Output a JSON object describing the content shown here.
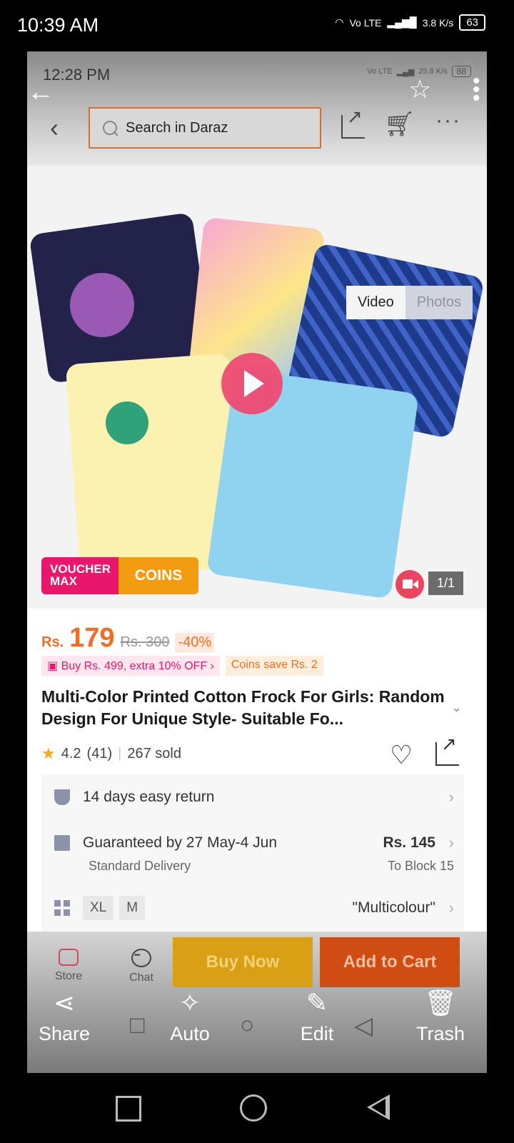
{
  "system": {
    "time": "10:39 AM",
    "network": "Vo LTE",
    "speed": "3.8 K/s",
    "battery": "63"
  },
  "inner_status": {
    "time": "12:28 PM",
    "network": "Vo LTE",
    "speed": "25.8 K/s",
    "battery": "88"
  },
  "search": {
    "placeholder": "Search in Daraz"
  },
  "media": {
    "tabs": [
      "Video",
      "Photos"
    ],
    "counter": "1/1",
    "voucher_label": "VOUCHER MAX",
    "coins_label": "COINS"
  },
  "product": {
    "currency": "Rs.",
    "price": "179",
    "old_price": "Rs. 300",
    "discount": "-40%",
    "promo": "Buy Rs. 499, extra 10% OFF",
    "coins_save": "Coins save Rs. 2",
    "title": "Multi-Color Printed Cotton Frock For Girls: Random Design For Unique Style- Suitable Fo...",
    "rating": "4.2",
    "rating_count": "(41)",
    "sold": "267 sold"
  },
  "info": {
    "return": "14 days easy return",
    "delivery": "Guaranteed by 27 May-4 Jun",
    "delivery_type": "Standard Delivery",
    "delivery_price": "Rs. 145",
    "delivery_to": "To Block 15",
    "sizes": [
      "XL",
      "M"
    ],
    "color": "\"Multicolour\""
  },
  "bottom_bar": {
    "store": "Store",
    "chat": "Chat",
    "buy_now": "Buy Now",
    "add_to_cart": "Add to Cart"
  },
  "actions": {
    "share": "Share",
    "auto": "Auto",
    "edit": "Edit",
    "trash": "Trash"
  },
  "icons": {
    "back": "back-arrow-icon",
    "favorite": "star-icon",
    "more": "more-vertical-icon"
  },
  "colors": {
    "accent": "#f36c21",
    "voucher": "#e8176b",
    "coins": "#f39c12",
    "buy_now": "#d9a015",
    "add_to_cart": "#cf4d12"
  }
}
